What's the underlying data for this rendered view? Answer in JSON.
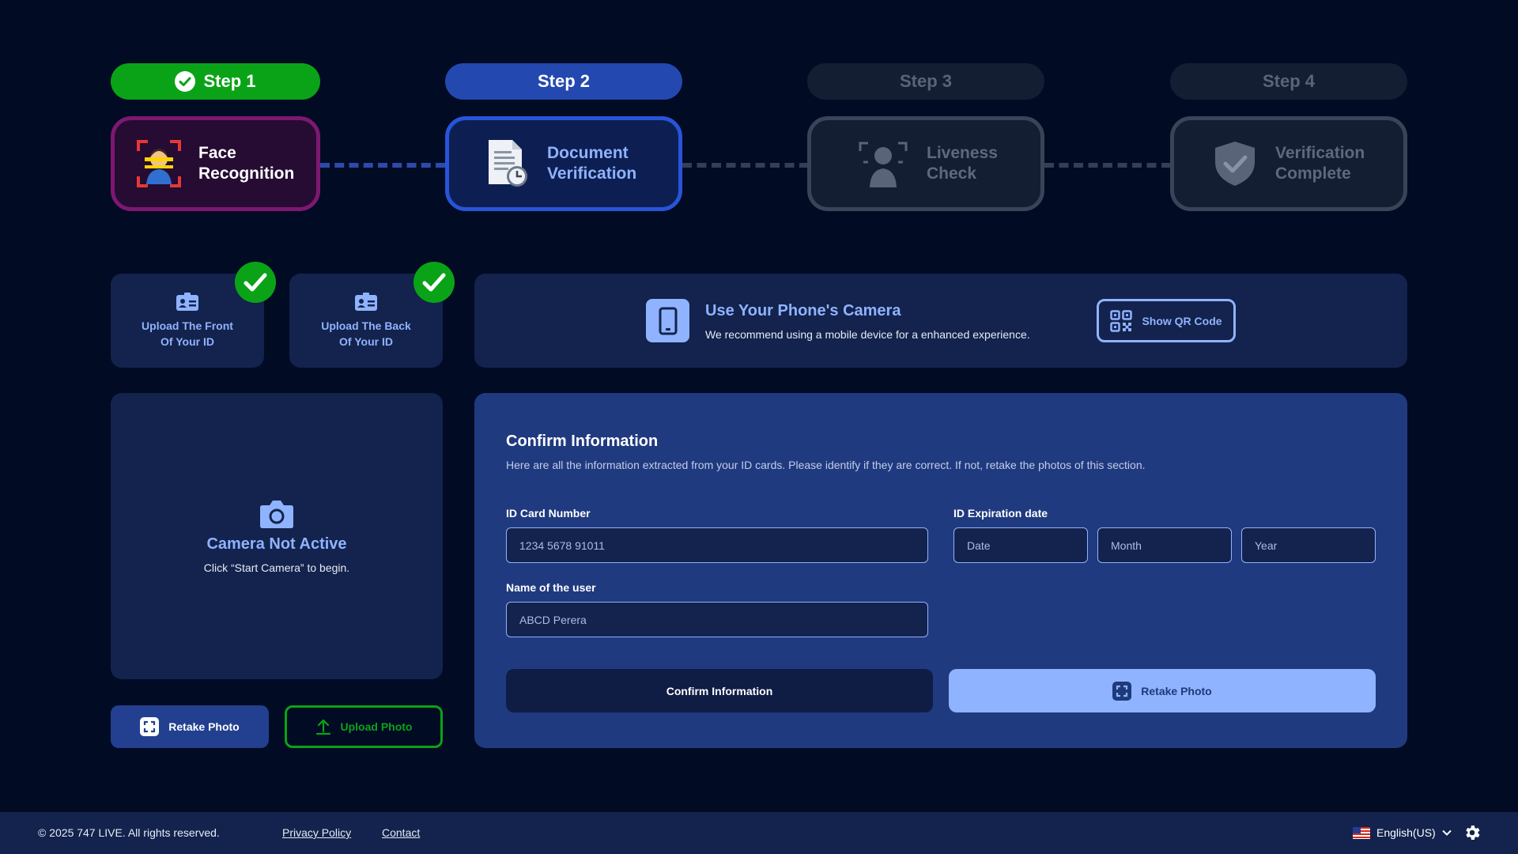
{
  "stepper": {
    "steps": [
      {
        "pill": "Step 1",
        "label_line1": "Face",
        "label_line2": "Recognition",
        "state": "done"
      },
      {
        "pill": "Step 2",
        "label_line1": "Document",
        "label_line2": "Verification",
        "state": "active"
      },
      {
        "pill": "Step 3",
        "label_line1": "Liveness",
        "label_line2": "Check",
        "state": "pending"
      },
      {
        "pill": "Step 4",
        "label_line1": "Verification",
        "label_line2": "Complete",
        "state": "pending"
      }
    ]
  },
  "uploads": {
    "front": {
      "line1": "Upload The Front",
      "line2": "Of Your ID",
      "done": true
    },
    "back": {
      "line1": "Upload The Back",
      "line2": "Of Your ID",
      "done": true
    }
  },
  "phone_banner": {
    "title": "Use Your Phone's Camera",
    "description": "We recommend using a mobile device for a enhanced experience.",
    "qr_button": "Show QR Code"
  },
  "camera": {
    "title": "Camera Not Active",
    "subtitle": "Click “Start Camera” to begin.",
    "retake_button": "Retake Photo",
    "upload_button": "Upload Photo"
  },
  "confirm": {
    "title": "Confirm Information",
    "description": "Here are all the information extracted from your ID cards. Please identify if they are correct. If not, retake the photos of this section.",
    "id_number_label": "ID Card Number",
    "id_number_value": "1234 5678 91011",
    "expiry_label": "ID Expiration date",
    "expiry_date_placeholder": "Date",
    "expiry_month_placeholder": "Month",
    "expiry_year_placeholder": "Year",
    "name_label": "Name of the user",
    "name_value": "ABCD Perera",
    "confirm_button": "Confirm Information",
    "retake_button": "Retake Photo"
  },
  "footer": {
    "copyright": "© 2025 747 LIVE. All rights reserved.",
    "privacy": "Privacy Policy",
    "contact": "Contact",
    "language": "English(US)"
  },
  "colors": {
    "background": "#020b24",
    "panel": "#13234d",
    "accent": "#8fb3ff",
    "success": "#0aa317",
    "primary": "#2348b0"
  }
}
